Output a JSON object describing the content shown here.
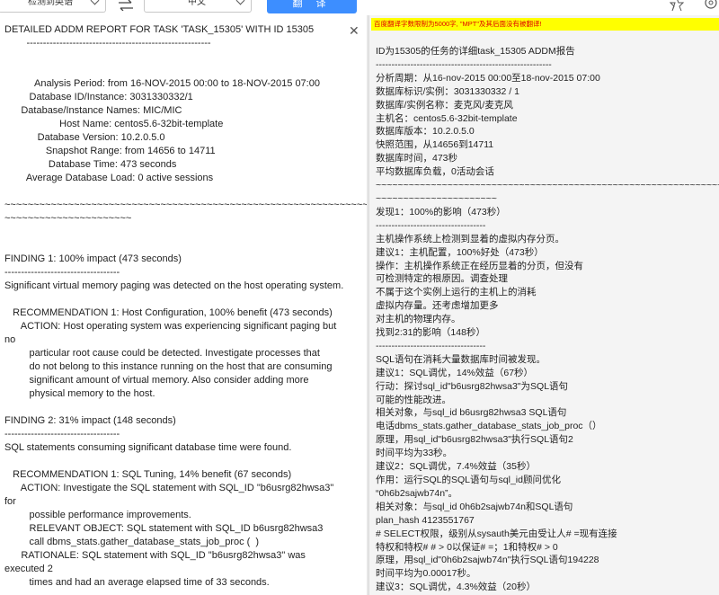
{
  "toolbar": {
    "source_lang": "检测到英语",
    "target_lang": "中文",
    "translate_label": "翻 译"
  },
  "left_pane": {
    "lines": [
      "DETAILED ADDM REPORT FOR TASK 'TASK_15305' WITH ID 15305",
      "        --------------------------------------------------------",
      "",
      "",
      "           Analysis Period: from 16-NOV-2015 00:00 to 18-NOV-2015 07:00",
      "         Database ID/Instance: 3031330332/1",
      "      Database/Instance Names: MIC/MIC",
      "                    Host Name: centos5.6-32bit-template",
      "            Database Version: 10.2.0.5.0",
      "               Snapshot Range: from 14656 to 14711",
      "                Database Time: 473 seconds",
      "        Average Database Load: 0 active sessions",
      "",
      "~~~~~~~~~~~~~~~~~~~~~~~~~~~~~~~~~~~~~~~~~~~~~~~~~~~~~~~~~~~~~~~~~~~~",
      "~~~~~~~~~~~~~~~~~~~~~~",
      "",
      "",
      "FINDING 1: 100% impact (473 seconds)",
      "-----------------------------------",
      "Significant virtual memory paging was detected on the host operating system.",
      "",
      "   RECOMMENDATION 1: Host Configuration, 100% benefit (473 seconds)",
      "      ACTION: Host operating system was experiencing significant paging but",
      "no",
      "         particular root cause could be detected. Investigate processes that",
      "         do not belong to this instance running on the host that are consuming",
      "         significant amount of virtual memory. Also consider adding more",
      "         physical memory to the host.",
      "",
      "FINDING 2: 31% impact (148 seconds)",
      "-----------------------------------",
      "SQL statements consuming significant database time were found.",
      "",
      "   RECOMMENDATION 1: SQL Tuning, 14% benefit (67 seconds)",
      "      ACTION: Investigate the SQL statement with SQL_ID \"b6usrg82hwsa3\"",
      "for",
      "         possible performance improvements.",
      "         RELEVANT OBJECT: SQL statement with SQL_ID b6usrg82hwsa3",
      "         call dbms_stats.gather_database_stats_job_proc (  )",
      "      RATIONALE: SQL statement with SQL_ID \"b6usrg82hwsa3\" was",
      "executed 2",
      "         times and had an average elapsed time of 33 seconds.",
      "",
      "   RECOMMENDATION 2: SQL Tuning, 7.4% benefit (35 seconds)"
    ]
  },
  "right_pane": {
    "notice": "百度翻译字数限制为5000字, \"MPT\"及其后面没有被翻译!",
    "lines": [
      "ID为15305的任务的详细task_15305 ADDM报告",
      "--------------------------------------------------------",
      "分析周期：从16-nov-2015 00:00至18-nov-2015 07:00",
      "数据库标识/实例：3031330332 / 1",
      "数据库/实例名称：麦克风/麦克风",
      "主机名：centos5.6-32bit-template",
      "数据库版本：10.2.0.5.0",
      "快照范围，从14656到14711",
      "数据库时间，473秒",
      "平均数据库负载，0活动会话",
      "~~~~~~~~~~~~~~~~~~~~~~~~~~~~~~~~~~~~~~~~~~~~~~~~~~~~~~~~~~~~~~~~~~~~~~~~",
      "~~~~~~~~~~~~~~~~~~~~~~",
      "发现1：100%的影响（473秒）",
      "-----------------------------------",
      "主机操作系统上检测到显着的虚拟内存分页。",
      "建议1：主机配置，100%好处（473秒）",
      "操作：主机操作系统正在经历显着的分页，但没有",
      "可检测特定的根原因。调查处理",
      "不属于这个实例上运行的主机上的消耗",
      "虚拟内存量。还考虑增加更多",
      "对主机的物理内存。",
      "找到2:31的影响（148秒）",
      "-----------------------------------",
      "SQL语句在消耗大量数据库时间被发现。",
      "建议1：SQL调优，14%效益（67秒）",
      "行动：探讨sql_id\"b6usrg82hwsa3\"为SQL语句",
      "可能的性能改进。",
      "相关对象，与sql_id b6usrg82hwsa3 SQL语句",
      "电话dbms_stats.gather_database_stats_job_proc（）",
      "原理，用sql_id\"b6usrg82hwsa3\"执行SQL语句2",
      "时间平均为33秒。",
      "建议2：SQL调优，7.4%效益（35秒）",
      "作用：运行SQL的SQL语句与sql_id顾问优化",
      "“0h6b2sajwb74n”。",
      "相关对象：与sql_id 0h6b2sajwb74n和SQL语句",
      "plan_hash 4123551767",
      "# SELECT权限，级别从sysauth美元由受让人# =现有连接",
      "特权和特权# # > 0以保证# =；1和特权# > 0",
      "原理，用sql_id\"0h6b2sajwb74n\"执行SQL语句194228",
      "时间平均为0.00017秒。",
      "建议3：SQL调优，4.3%效益（20秒）"
    ]
  }
}
